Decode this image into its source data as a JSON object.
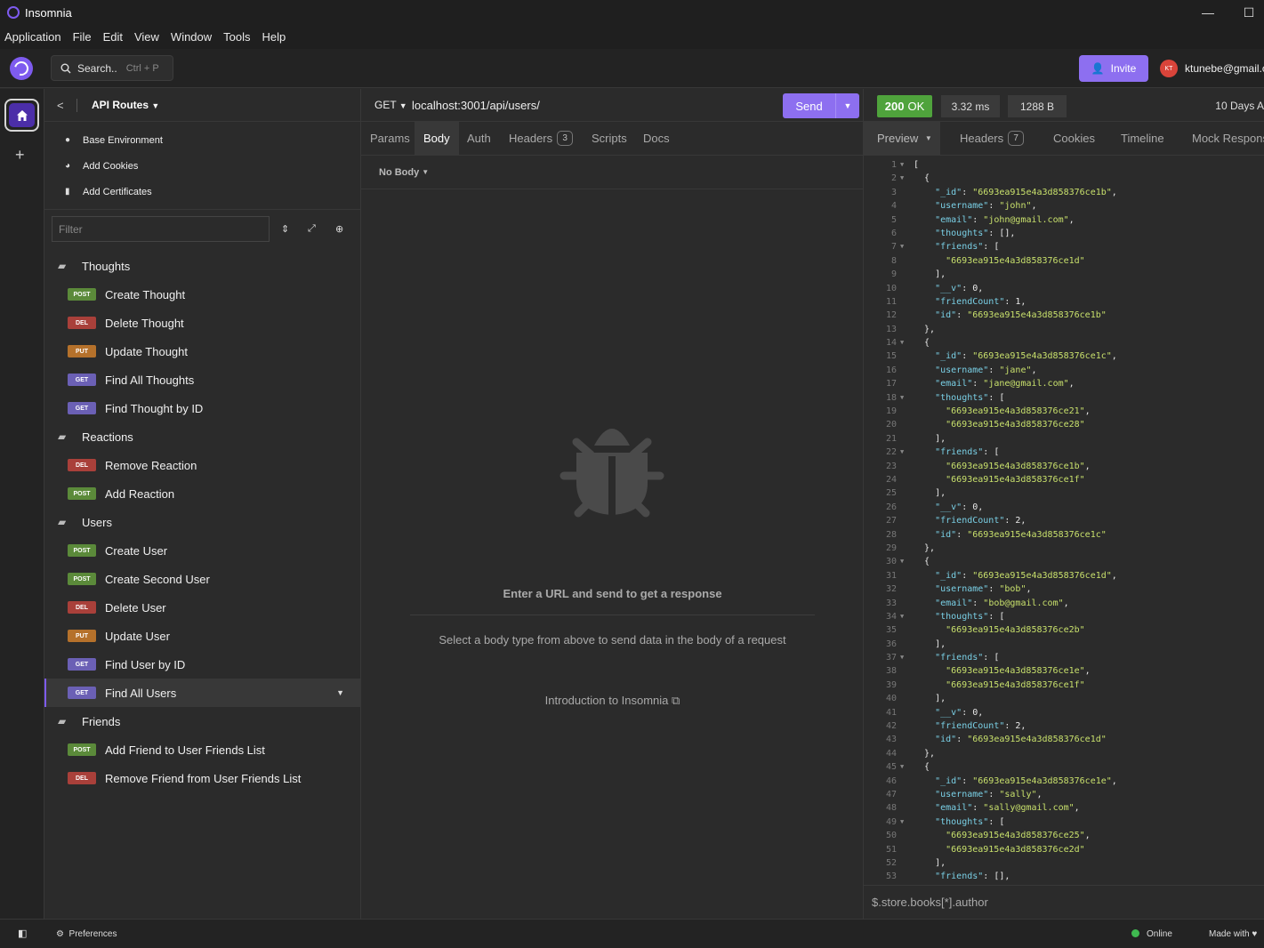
{
  "window": {
    "title": "Insomnia",
    "minimize": "—",
    "maximize": "☐"
  },
  "menu": [
    "Application",
    "File",
    "Edit",
    "View",
    "Window",
    "Tools",
    "Help"
  ],
  "topbar": {
    "search_label": "Search..",
    "search_shortcut": "Ctrl + P",
    "invite_label": "Invite",
    "avatar_initials": "KT",
    "user_email": "ktunebe@gmail.c"
  },
  "sidebar": {
    "project": "API Routes",
    "links": [
      {
        "label": "Base Environment",
        "icon": "globe-icon"
      },
      {
        "label": "Add Cookies",
        "icon": "cookie-icon"
      },
      {
        "label": "Add Certificates",
        "icon": "certificate-icon"
      }
    ],
    "filter_placeholder": "Filter",
    "tree": [
      {
        "type": "folder",
        "label": "Thoughts"
      },
      {
        "type": "req",
        "method": "POST",
        "label": "Create Thought"
      },
      {
        "type": "req",
        "method": "DEL",
        "label": "Delete Thought"
      },
      {
        "type": "req",
        "method": "PUT",
        "label": "Update Thought"
      },
      {
        "type": "req",
        "method": "GET",
        "label": "Find All Thoughts"
      },
      {
        "type": "req",
        "method": "GET",
        "label": "Find Thought by ID"
      },
      {
        "type": "folder",
        "label": "Reactions"
      },
      {
        "type": "req",
        "method": "DEL",
        "label": "Remove Reaction"
      },
      {
        "type": "req",
        "method": "POST",
        "label": "Add Reaction"
      },
      {
        "type": "folder",
        "label": "Users"
      },
      {
        "type": "req",
        "method": "POST",
        "label": "Create User"
      },
      {
        "type": "req",
        "method": "POST",
        "label": "Create Second User"
      },
      {
        "type": "req",
        "method": "DEL",
        "label": "Delete User"
      },
      {
        "type": "req",
        "method": "PUT",
        "label": "Update User"
      },
      {
        "type": "req",
        "method": "GET",
        "label": "Find User by ID"
      },
      {
        "type": "req",
        "method": "GET",
        "label": "Find All Users",
        "active": true
      },
      {
        "type": "folder",
        "label": "Friends"
      },
      {
        "type": "req",
        "method": "POST",
        "label": "Add Friend to User Friends List"
      },
      {
        "type": "req",
        "method": "DEL",
        "label": "Remove Friend from User Friends List"
      }
    ]
  },
  "request": {
    "method": "GET",
    "url": "localhost:3001/api/users/",
    "send_label": "Send",
    "tabs": {
      "params": "Params",
      "body": "Body",
      "auth": "Auth",
      "headers": "Headers",
      "headers_count": "3",
      "scripts": "Scripts",
      "docs": "Docs"
    },
    "body_type": "No Body",
    "empty_title": "Enter a URL and send to get a response",
    "empty_sub": "Select a body type from above to send data in the body of a request",
    "intro_link": "Introduction to Insomnia"
  },
  "response": {
    "status_code": "200",
    "status_text": "OK",
    "time": "3.32 ms",
    "size": "1288 B",
    "ago": "10 Days A",
    "tabs": {
      "preview": "Preview",
      "headers": "Headers",
      "headers_count": "7",
      "cookies": "Cookies",
      "timeline": "Timeline",
      "mock": "Mock Respons"
    },
    "filter_placeholder": "$.store.books[*].author",
    "lines": [
      "[",
      "  {",
      "    \"_id\": \"6693ea915e4a3d858376ce1b\",",
      "    \"username\": \"john\",",
      "    \"email\": \"john@gmail.com\",",
      "    \"thoughts\": [],",
      "    \"friends\": [",
      "      \"6693ea915e4a3d858376ce1d\"",
      "    ],",
      "    \"__v\": 0,",
      "    \"friendCount\": 1,",
      "    \"id\": \"6693ea915e4a3d858376ce1b\"",
      "  },",
      "  {",
      "    \"_id\": \"6693ea915e4a3d858376ce1c\",",
      "    \"username\": \"jane\",",
      "    \"email\": \"jane@gmail.com\",",
      "    \"thoughts\": [",
      "      \"6693ea915e4a3d858376ce21\",",
      "      \"6693ea915e4a3d858376ce28\"",
      "    ],",
      "    \"friends\": [",
      "      \"6693ea915e4a3d858376ce1b\",",
      "      \"6693ea915e4a3d858376ce1f\"",
      "    ],",
      "    \"__v\": 0,",
      "    \"friendCount\": 2,",
      "    \"id\": \"6693ea915e4a3d858376ce1c\"",
      "  },",
      "  {",
      "    \"_id\": \"6693ea915e4a3d858376ce1d\",",
      "    \"username\": \"bob\",",
      "    \"email\": \"bob@gmail.com\",",
      "    \"thoughts\": [",
      "      \"6693ea915e4a3d858376ce2b\"",
      "    ],",
      "    \"friends\": [",
      "      \"6693ea915e4a3d858376ce1e\",",
      "      \"6693ea915e4a3d858376ce1f\"",
      "    ],",
      "    \"__v\": 0,",
      "    \"friendCount\": 2,",
      "    \"id\": \"6693ea915e4a3d858376ce1d\"",
      "  },",
      "  {",
      "    \"_id\": \"6693ea915e4a3d858376ce1e\",",
      "    \"username\": \"sally\",",
      "    \"email\": \"sally@gmail.com\",",
      "    \"thoughts\": [",
      "      \"6693ea915e4a3d858376ce25\",",
      "      \"6693ea915e4a3d858376ce2d\"",
      "    ],",
      "    \"friends\": [],"
    ],
    "fold_lines": [
      1,
      2,
      7,
      14,
      18,
      22,
      30,
      34,
      37,
      45,
      49
    ]
  },
  "footer": {
    "preferences": "Preferences",
    "online": "Online",
    "made_with": "Made with"
  },
  "colors": {
    "accent": "#8d6ff0",
    "post": "#5b8a3a",
    "del": "#a9403a",
    "put": "#b5712b",
    "get": "#6b60b5",
    "ok": "#4fa33c"
  }
}
